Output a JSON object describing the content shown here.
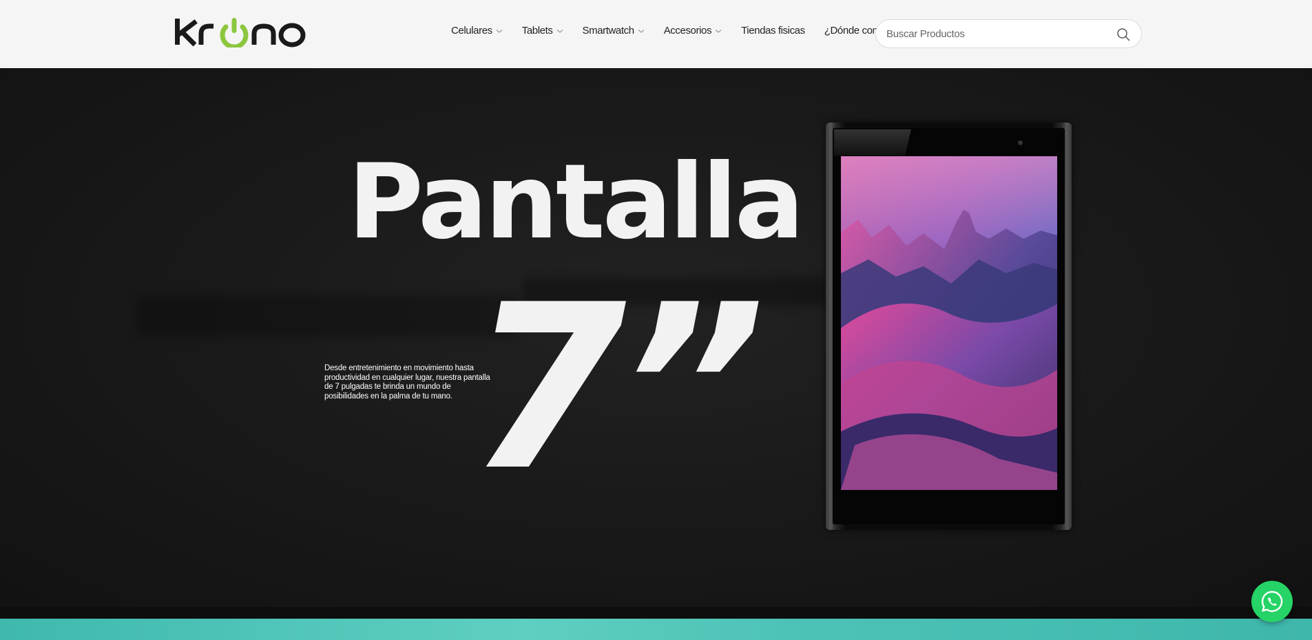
{
  "brand": {
    "logo_text": "krono",
    "accent_color": "#8cc63f"
  },
  "nav": {
    "items": [
      {
        "label": "Celulares",
        "has_dropdown": true
      },
      {
        "label": "Tablets",
        "has_dropdown": true
      },
      {
        "label": "Smartwatch",
        "has_dropdown": true
      },
      {
        "label": "Accesorios",
        "has_dropdown": true
      },
      {
        "label": "Tiendas fisicas",
        "has_dropdown": false
      },
      {
        "label": "¿Dónde comprar?",
        "has_dropdown": true
      }
    ]
  },
  "search": {
    "placeholder": "Buscar Productos",
    "value": "",
    "icon": "search-icon"
  },
  "hero": {
    "headline": "Pantalla",
    "size_value": "7”",
    "description": "Desde entretenimiento en movimiento hasta productividad en cualquier lugar, nuestra pantalla de 7 pulgadas te brinda un mundo de posibilidades en la palma de tu mano."
  },
  "whatsapp": {
    "icon": "whatsapp-icon",
    "color": "#25d366"
  },
  "colors": {
    "header_bg": "#f5f5f5",
    "hero_bg": "#161616",
    "band": "#4fc4b8"
  }
}
